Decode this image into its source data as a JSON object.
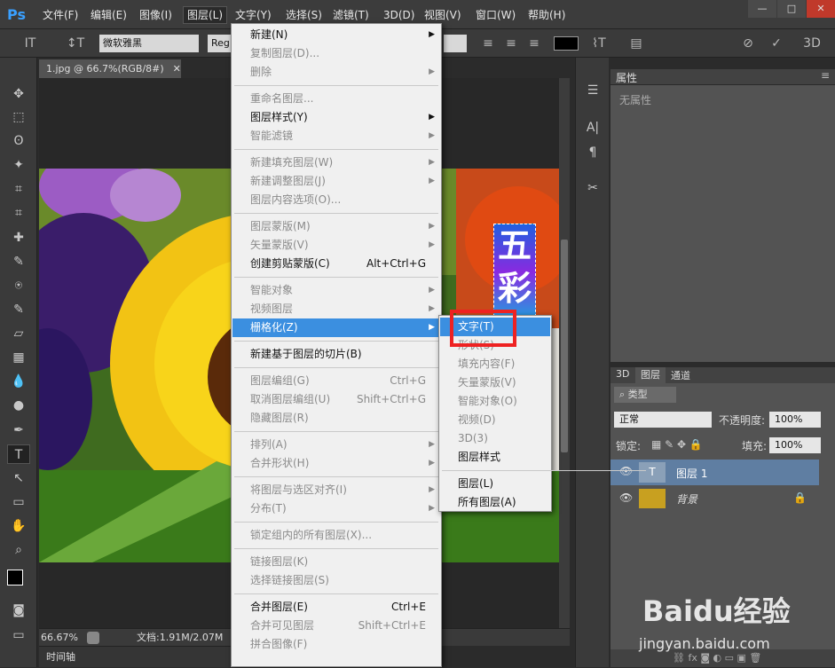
{
  "menubar": {
    "logo": "Ps",
    "items": [
      "文件(F)",
      "编辑(E)",
      "图像(I)",
      "图层(L)",
      "文字(Y)",
      "选择(S)",
      "滤镜(T)",
      "3D(D)",
      "视图(V)",
      "窗口(W)",
      "帮助(H)"
    ],
    "window_controls": [
      "—",
      "□",
      "✕"
    ]
  },
  "options": {
    "font_family": "微软雅黑",
    "font_style": "Reg"
  },
  "doc": {
    "tab": "1.jpg @ 66.7%(RGB/8#)",
    "zoom": "66.67%",
    "docsize": "文档:1.91M/2.07M",
    "timeline": "时间轴",
    "text_layer_chars": [
      "五",
      "彩"
    ]
  },
  "layer_menu": [
    {
      "label": "新建(N)",
      "arrow": true
    },
    {
      "label": "复制图层(D)...",
      "disabled": true
    },
    {
      "label": "删除",
      "disabled": true,
      "arrow": true
    },
    {
      "sep": true
    },
    {
      "label": "重命名图层...",
      "disabled": true
    },
    {
      "label": "图层样式(Y)",
      "arrow": true
    },
    {
      "label": "智能滤镜",
      "disabled": true,
      "arrow": true
    },
    {
      "sep": true
    },
    {
      "label": "新建填充图层(W)",
      "disabled": true,
      "arrow": true
    },
    {
      "label": "新建调整图层(J)",
      "disabled": true,
      "arrow": true
    },
    {
      "label": "图层内容选项(O)...",
      "disabled": true
    },
    {
      "sep": true
    },
    {
      "label": "图层蒙版(M)",
      "disabled": true,
      "arrow": true
    },
    {
      "label": "矢量蒙版(V)",
      "disabled": true,
      "arrow": true
    },
    {
      "label": "创建剪贴蒙版(C)",
      "shortcut": "Alt+Ctrl+G"
    },
    {
      "sep": true
    },
    {
      "label": "智能对象",
      "disabled": true,
      "arrow": true
    },
    {
      "label": "视频图层",
      "disabled": true,
      "arrow": true
    },
    {
      "label": "栅格化(Z)",
      "arrow": true,
      "highlight": true
    },
    {
      "sep": true
    },
    {
      "label": "新建基于图层的切片(B)"
    },
    {
      "sep": true
    },
    {
      "label": "图层编组(G)",
      "disabled": true,
      "shortcut": "Ctrl+G"
    },
    {
      "label": "取消图层编组(U)",
      "disabled": true,
      "shortcut": "Shift+Ctrl+G"
    },
    {
      "label": "隐藏图层(R)",
      "disabled": true
    },
    {
      "sep": true
    },
    {
      "label": "排列(A)",
      "disabled": true,
      "arrow": true
    },
    {
      "label": "合并形状(H)",
      "disabled": true,
      "arrow": true
    },
    {
      "sep": true
    },
    {
      "label": "将图层与选区对齐(I)",
      "disabled": true,
      "arrow": true
    },
    {
      "label": "分布(T)",
      "disabled": true,
      "arrow": true
    },
    {
      "sep": true
    },
    {
      "label": "锁定组内的所有图层(X)...",
      "disabled": true
    },
    {
      "sep": true
    },
    {
      "label": "链接图层(K)",
      "disabled": true
    },
    {
      "label": "选择链接图层(S)",
      "disabled": true
    },
    {
      "sep": true
    },
    {
      "label": "合并图层(E)",
      "shortcut": "Ctrl+E"
    },
    {
      "label": "合并可见图层",
      "disabled": true,
      "shortcut": "Shift+Ctrl+E"
    },
    {
      "label": "拼合图像(F)",
      "disabled": true
    }
  ],
  "raster_menu": [
    {
      "label": "文字(T)",
      "highlight": true
    },
    {
      "label": "形状(S)",
      "disabled": true
    },
    {
      "label": "填充内容(F)",
      "disabled": true
    },
    {
      "label": "矢量蒙版(V)",
      "disabled": true
    },
    {
      "label": "智能对象(O)",
      "disabled": true
    },
    {
      "label": "视频(D)",
      "disabled": true
    },
    {
      "label": "3D(3)",
      "disabled": true
    },
    {
      "label": "图层样式"
    },
    {
      "sep": true
    },
    {
      "label": "图层(L)"
    },
    {
      "label": "所有图层(A)"
    }
  ],
  "properties": {
    "title": "属性",
    "empty": "无属性"
  },
  "layers_panel": {
    "tabs": [
      "3D",
      "图层",
      "通道"
    ],
    "filter": "类型",
    "blend": "正常",
    "opacity_label": "不透明度:",
    "opacity": "100%",
    "lock_label": "锁定:",
    "fill_label": "填充:",
    "fill": "100%",
    "layers": [
      {
        "name": "图层 1",
        "type": "text",
        "selected": true
      },
      {
        "name": "背景",
        "type": "image",
        "locked": true
      }
    ]
  },
  "watermark": {
    "brand": "Baidu经验",
    "url": "jingyan.baidu.com"
  },
  "colors": {
    "highlight": "#3b8fe0",
    "menu_bg": "#f0f0f0",
    "panel": "#535353",
    "red_box": "#e22222"
  }
}
